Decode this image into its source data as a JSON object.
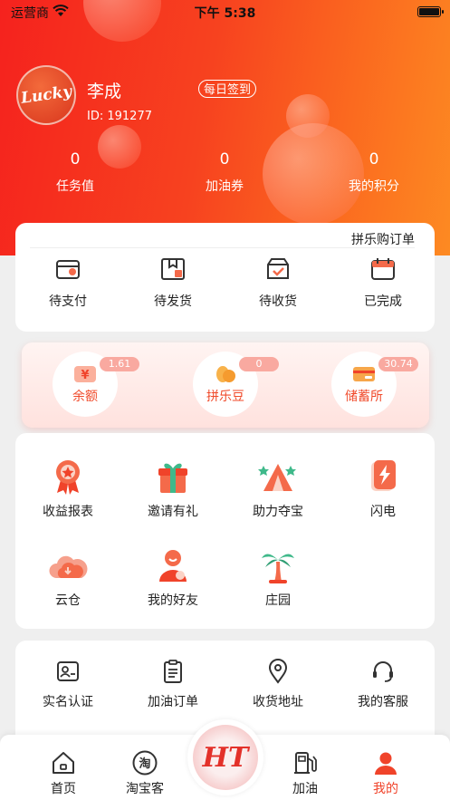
{
  "status_bar": {
    "carrier": "运营商",
    "time": "下午 5:38"
  },
  "profile": {
    "avatar_text": "Lucky",
    "name": "李成",
    "id_text": "ID: 191277",
    "signin_label": "每日签到"
  },
  "stats": [
    {
      "value": "0",
      "label": "任务值"
    },
    {
      "value": "0",
      "label": "加油券"
    },
    {
      "value": "0",
      "label": "我的积分"
    }
  ],
  "orders": {
    "link_label": "拼乐购订单",
    "items": [
      {
        "label": "待支付",
        "icon": "wallet-card-icon"
      },
      {
        "label": "待发货",
        "icon": "package-box-icon"
      },
      {
        "label": "待收货",
        "icon": "delivery-box-icon"
      },
      {
        "label": "已完成",
        "icon": "calendar-done-icon"
      }
    ]
  },
  "wallet": [
    {
      "label": "余额",
      "badge": "1.61",
      "icon": "balance-icon"
    },
    {
      "label": "拼乐豆",
      "badge": "0",
      "icon": "bean-icon"
    },
    {
      "label": "储蓄所",
      "badge": "30.74",
      "icon": "savings-card-icon"
    }
  ],
  "tools": [
    {
      "label": "收益报表",
      "icon": "medal-icon"
    },
    {
      "label": "邀请有礼",
      "icon": "gift-icon"
    },
    {
      "label": "助力夺宝",
      "icon": "tent-icon"
    },
    {
      "label": "闪电",
      "icon": "lightning-icon"
    },
    {
      "label": "云仓",
      "icon": "cloud-warehouse-icon"
    },
    {
      "label": "我的好友",
      "icon": "friends-icon"
    },
    {
      "label": "庄园",
      "icon": "palm-tree-icon"
    }
  ],
  "services": [
    {
      "label": "实名认证",
      "icon": "id-card-icon"
    },
    {
      "label": "加油订单",
      "icon": "clipboard-icon"
    },
    {
      "label": "收货地址",
      "icon": "location-pin-icon"
    },
    {
      "label": "我的客服",
      "icon": "headset-icon"
    }
  ],
  "tabs": [
    {
      "label": "首页",
      "icon": "home-icon"
    },
    {
      "label": "淘宝客",
      "icon": "taobao-icon",
      "icon_text": "淘"
    },
    {
      "label": "加油",
      "icon": "fuel-pump-icon"
    },
    {
      "label": "我的",
      "icon": "person-icon"
    }
  ],
  "center_tab": {
    "logo_text": "HT"
  },
  "colors": {
    "header_start": "#f5221e",
    "header_end": "#fd8a22",
    "accent": "#f0432a"
  }
}
